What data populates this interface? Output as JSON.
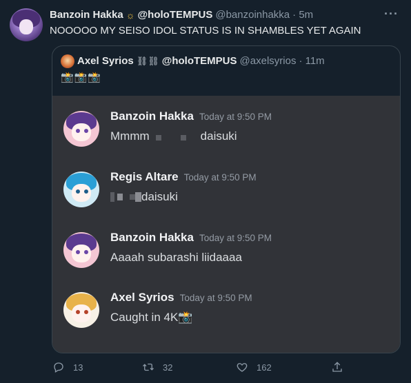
{
  "tweet": {
    "author_name": "Banzoin Hakka",
    "author_suffix": "@holoTEMPUS",
    "handle": "@banzoinhakka",
    "time": "· 5m",
    "text": "NOOOOO MY SEISO IDOL STATUS IS IN SHAMBLES YET AGAIN"
  },
  "quote": {
    "author_name": "Axel Syrios",
    "author_suffix": "@holoTEMPUS",
    "handle": "@axelsyrios",
    "time": "· 11m",
    "emoji_text": "📸📸📸"
  },
  "discord_messages": [
    {
      "author": "Banzoin Hakka",
      "time": "Today at 9:50 PM",
      "text_before": "Mmmm",
      "text_after": "daisuki"
    },
    {
      "author": "Regis Altare",
      "time": "Today at 9:50 PM",
      "text_before": "",
      "text_after": "daisuki"
    },
    {
      "author": "Banzoin Hakka",
      "time": "Today at 9:50 PM",
      "text": "Aaaah subarashi liidaaaa"
    },
    {
      "author": "Axel Syrios",
      "time": "Today at 9:50 PM",
      "text": "Caught in 4K📸"
    }
  ],
  "actions": {
    "replies": "13",
    "retweets": "32",
    "likes": "162"
  },
  "icons": {
    "more": "more-icon",
    "sun": "sun-icon",
    "chain": "chain-icon",
    "reply": "reply-icon",
    "retweet": "retweet-icon",
    "like": "like-icon",
    "share": "share-icon"
  },
  "colors": {
    "background": "#15202b",
    "discord_background": "#313338",
    "muted_text": "#8b98a5",
    "primary_text": "#e7e9ea"
  }
}
